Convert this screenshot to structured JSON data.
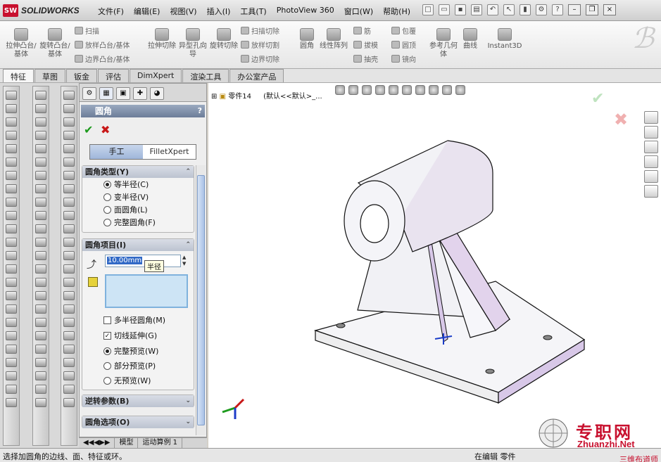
{
  "app": {
    "name": "SOLIDWORKS",
    "logo_mark": "SW"
  },
  "menu": [
    "文件(F)",
    "编辑(E)",
    "视图(V)",
    "插入(I)",
    "工具(T)",
    "PhotoView 360",
    "窗口(W)",
    "帮助(H)"
  ],
  "command_manager": {
    "large": [
      {
        "label": "拉伸凸台/基体",
        "icon": "extrude-boss-icon"
      },
      {
        "label": "旋转凸台/基体",
        "icon": "revolve-boss-icon"
      },
      {
        "label": "拉伸切除",
        "icon": "extrude-cut-icon"
      },
      {
        "label": "异型孔向导",
        "icon": "hole-wizard-icon"
      },
      {
        "label": "旋转切除",
        "icon": "revolve-cut-icon"
      },
      {
        "label": "圆角",
        "icon": "fillet-icon"
      },
      {
        "label": "线性阵列",
        "icon": "linear-pattern-icon"
      },
      {
        "label": "参考几何体",
        "icon": "reference-geometry-icon"
      },
      {
        "label": "曲线",
        "icon": "curves-icon"
      },
      {
        "label": "Instant3D",
        "icon": "instant3d-icon"
      }
    ],
    "small": [
      "扫描",
      "放样凸台/基体",
      "边界凸台/基体",
      "扫描切除",
      "放样切割",
      "边界切除",
      "筋",
      "拔模",
      "抽壳",
      "包覆",
      "圆顶",
      "镜向"
    ]
  },
  "tabs": [
    "特征",
    "草图",
    "钣金",
    "评估",
    "DimXpert",
    "渲染工具",
    "办公室产品"
  ],
  "property_manager": {
    "title": "圆角",
    "help": "?",
    "modes": [
      "手工",
      "FilletXpert"
    ],
    "groups": {
      "type": {
        "title": "圆角类型(Y)",
        "options": [
          "等半径(C)",
          "变半径(V)",
          "面圆角(L)",
          "完整圆角(F)"
        ],
        "selected": 0
      },
      "items": {
        "title": "圆角项目(I)",
        "radius": "10.00mm",
        "tooltip": "半径",
        "checks": [
          {
            "label": "多半径圆角(M)",
            "checked": false
          },
          {
            "label": "切线延伸(G)",
            "checked": true
          }
        ],
        "preview": [
          "完整预览(W)",
          "部分预览(P)",
          "无预览(W)"
        ],
        "preview_selected": 0
      },
      "setback": {
        "title": "逆转参数(B)"
      },
      "options": {
        "title": "圆角选项(O)"
      }
    }
  },
  "bottom_tabs": [
    "模型",
    "运动算例 1"
  ],
  "tree": {
    "label": "零件14",
    "config": "(默认<<默认>_..."
  },
  "status": {
    "left": "选择加圆角的边线、面、特征或环。",
    "mid": "在编辑 零件"
  },
  "watermark": {
    "cn": "专职网",
    "en": "Zhuanzhi.Net",
    "sub": "三维布道师"
  },
  "colors": {
    "accent": "#c8102e",
    "panel_title": "#6c7d98",
    "part_face": "#f4f4f8",
    "highlight": "#d8c8e8"
  }
}
